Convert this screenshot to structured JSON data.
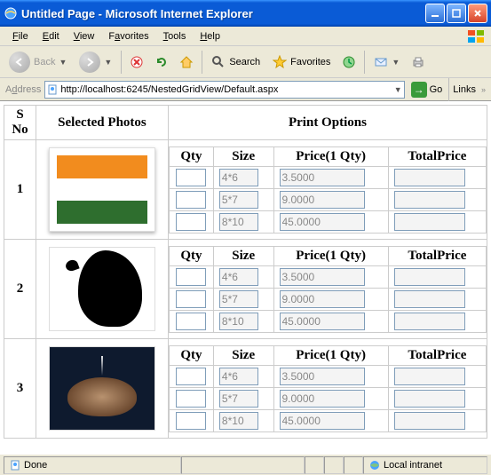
{
  "window": {
    "title": "Untitled Page - Microsoft Internet Explorer"
  },
  "menu": {
    "file": "File",
    "edit": "Edit",
    "view": "View",
    "favorites": "Favorites",
    "tools": "Tools",
    "help": "Help"
  },
  "toolbar": {
    "back": "Back",
    "search": "Search",
    "favorites": "Favorites"
  },
  "address": {
    "label": "Address",
    "url": "http://localhost:6245/NestedGridView/Default.aspx",
    "go": "Go",
    "links": "Links"
  },
  "grid": {
    "headers": {
      "sno": "S No",
      "photos": "Selected Photos",
      "options": "Print Options"
    },
    "inner_headers": {
      "qty": "Qty",
      "size": "Size",
      "price": "Price(1 Qty)",
      "total": "TotalPrice"
    },
    "price_rows": [
      {
        "qty": "",
        "size": "4*6",
        "price": "3.5000",
        "total": ""
      },
      {
        "qty": "",
        "size": "5*7",
        "price": "9.0000",
        "total": ""
      },
      {
        "qty": "",
        "size": "8*10",
        "price": "45.0000",
        "total": ""
      }
    ],
    "rows": [
      {
        "sno": "1"
      },
      {
        "sno": "2"
      },
      {
        "sno": "3"
      }
    ]
  },
  "status": {
    "done": "Done",
    "zone": "Local intranet"
  }
}
